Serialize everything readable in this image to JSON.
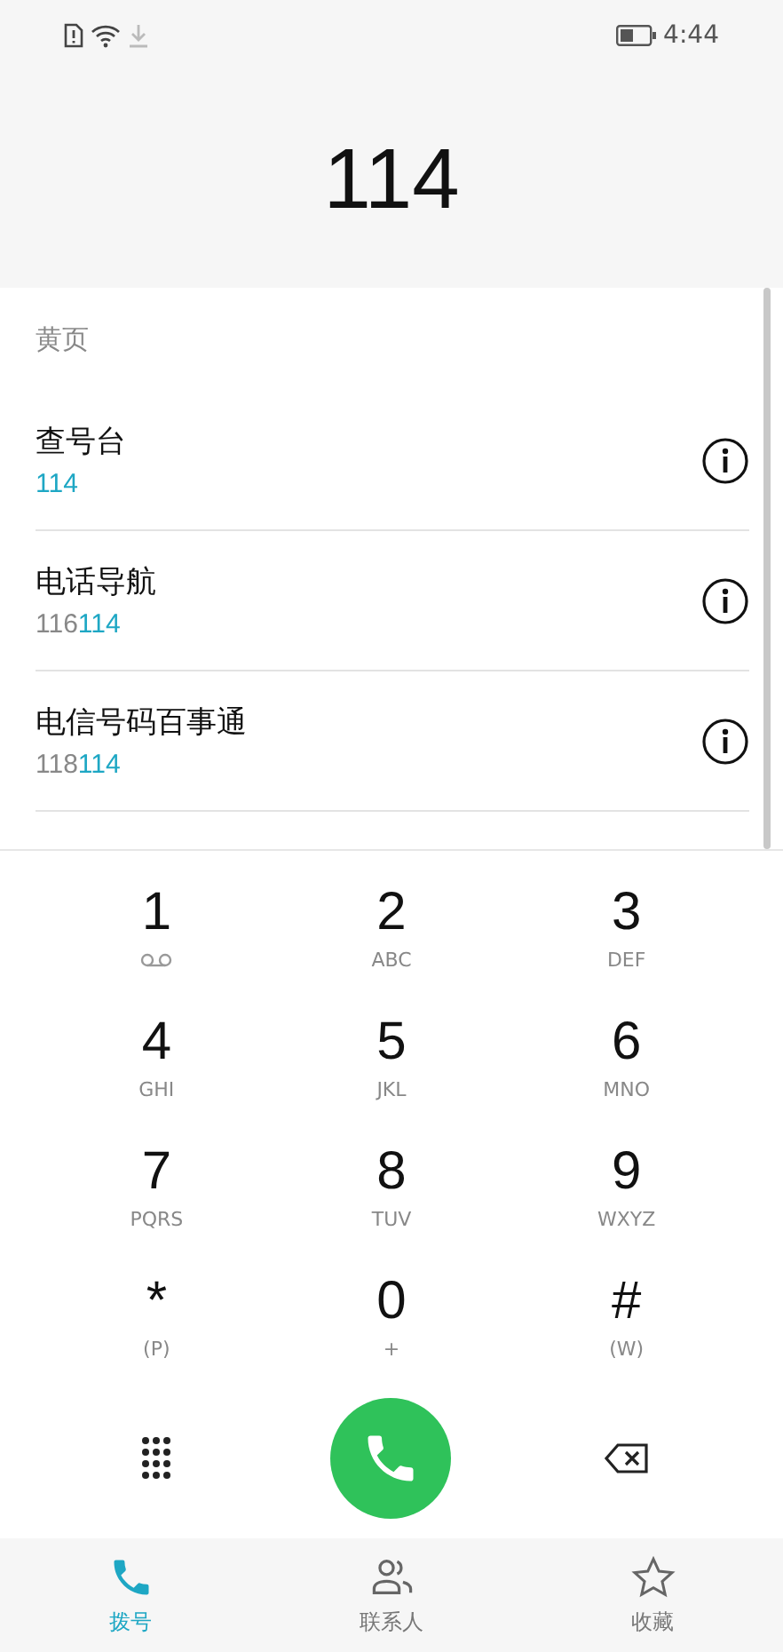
{
  "status_bar": {
    "time": "4:44"
  },
  "dialed_number": "114",
  "yellow_pages": {
    "header": "黄页",
    "entries": [
      {
        "name": "查号台",
        "number_match": "114"
      },
      {
        "name": "电话导航",
        "number_prefix": "116",
        "number_match": "114"
      },
      {
        "name": "电信号码百事通",
        "number_prefix": "118",
        "number_match": "114"
      }
    ]
  },
  "keypad": [
    {
      "digit": "1",
      "kind": "voicemail"
    },
    {
      "digit": "2",
      "kind": "letters",
      "letters": "ABC"
    },
    {
      "digit": "3",
      "kind": "letters",
      "letters": "DEF"
    },
    {
      "digit": "4",
      "kind": "letters",
      "letters": "GHI"
    },
    {
      "digit": "5",
      "kind": "letters",
      "letters": "JKL"
    },
    {
      "digit": "6",
      "kind": "letters",
      "letters": "MNO"
    },
    {
      "digit": "7",
      "kind": "letters",
      "letters": "PQRS"
    },
    {
      "digit": "8",
      "kind": "letters",
      "letters": "TUV"
    },
    {
      "digit": "9",
      "kind": "letters",
      "letters": "WXYZ"
    },
    {
      "digit": "*",
      "kind": "letters",
      "letters": "(P)"
    },
    {
      "digit": "0",
      "kind": "letters",
      "letters": "+"
    },
    {
      "digit": "#",
      "kind": "letters",
      "letters": "(W)"
    }
  ],
  "bottom_nav": [
    {
      "label": "拨号",
      "kind": "phone",
      "selected": true
    },
    {
      "label": "联系人",
      "kind": "contacts",
      "selected": false
    },
    {
      "label": "收藏",
      "kind": "star",
      "selected": false
    }
  ]
}
